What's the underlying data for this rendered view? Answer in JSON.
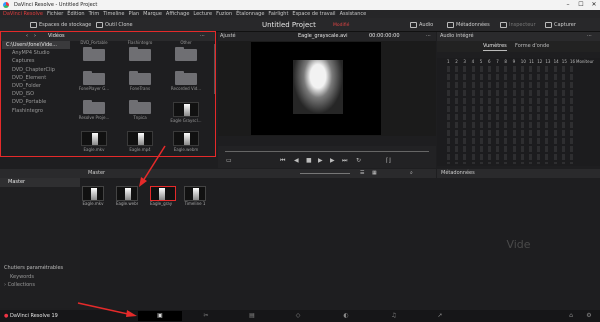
{
  "window": {
    "title": "DaVinci Resolve - Untitled Project"
  },
  "menu": [
    "DaVinci Resolve",
    "Fichier",
    "Édition",
    "Trim",
    "Timeline",
    "Plan",
    "Marque",
    "Affichage",
    "Lecture",
    "Fuzion",
    "Étalonnage",
    "Fairlight",
    "Espace de travail",
    "Assistance"
  ],
  "toolbar": {
    "media_storage": "Espaces de stockage",
    "clone_tool": "Outil Clone",
    "project_title": "Untitled Project",
    "project_status": "Modifié",
    "audio": "Audio",
    "metadata": "Métadonnées",
    "inspector": "Inspecteur",
    "capture": "Capturer"
  },
  "media_pool": {
    "header": "Vidéos",
    "tree": [
      "C:\\Users\\fone\\Vide...",
      "AnyMP4 Studio",
      "Captures",
      "DVD_ChapterClip",
      "DVD_Element",
      "DVD_Folder",
      "DVD_ISO",
      "DVD_Portable",
      "Flashintegro"
    ],
    "tiles": [
      {
        "label": "DVD_Portable",
        "kind": "folder"
      },
      {
        "label": "Flashintegro",
        "kind": "folder"
      },
      {
        "label": "Other",
        "kind": "folder"
      },
      {
        "label": "FonePlayer G...",
        "kind": "folder"
      },
      {
        "label": "FoneTrans",
        "kind": "folder"
      },
      {
        "label": "Recorded Vid...",
        "kind": "folder"
      },
      {
        "label": "Resolve Proje...",
        "kind": "folder"
      },
      {
        "label": "Tnpica",
        "kind": "folder"
      },
      {
        "label": "Eagle Grayscl...",
        "kind": "clip"
      },
      {
        "label": "Eagle.mkv",
        "kind": "clip"
      },
      {
        "label": "Eagle.mp4",
        "kind": "clip"
      },
      {
        "label": "Eagle.webm",
        "kind": "clip"
      }
    ]
  },
  "viewer": {
    "fit": "Ajusté",
    "clip_name": "Eagle_grayscale.avi",
    "timecode": "00:00:00:00"
  },
  "audio": {
    "header": "Audio intégré",
    "tabs": [
      "Vumètres",
      "Forme d'onde"
    ],
    "channels": [
      "1",
      "2",
      "3",
      "4",
      "5",
      "6",
      "7",
      "8",
      "9",
      "10",
      "11",
      "12",
      "13",
      "14",
      "15",
      "16"
    ],
    "monitor": "Moniteur"
  },
  "bins": {
    "header": "Master",
    "master": "Master",
    "smart_bins": "Chutiers paramétrables",
    "keywords": "Keywords",
    "collections": "Collections"
  },
  "clips": {
    "header": "Master",
    "items": [
      "Eagle.mkv",
      "Eagle.webm",
      "Eagle_grays...",
      "Timeline 1"
    ]
  },
  "metadata": {
    "header": "Métadonnées",
    "empty": "Vide"
  },
  "bottom": {
    "app_name": "DaVinci Resolve 19"
  },
  "colors": {
    "accent": "#e52a2a",
    "bg": "#1e1e20"
  }
}
